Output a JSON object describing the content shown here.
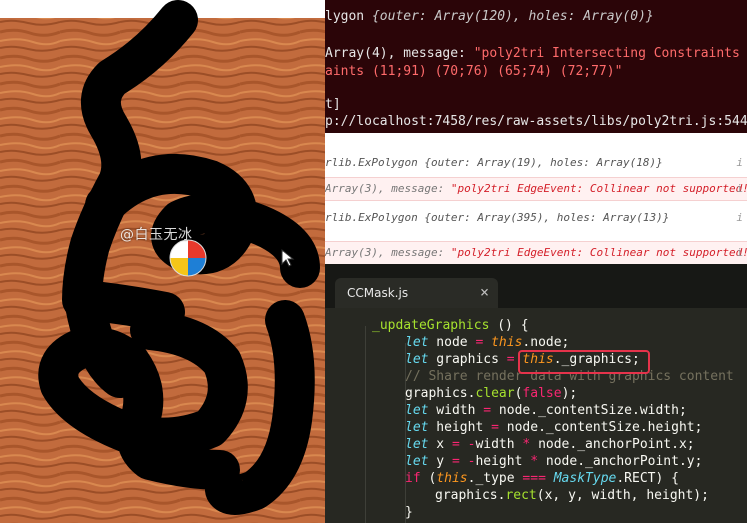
{
  "console": {
    "top": {
      "line1_label": "lygon ",
      "line1_detail": "{outer: Array(120), holes: Array(0)}",
      "line2_key": "Array(4), message: ",
      "line2_msg": "\"poly2tri Intersecting Constraints (",
      "line3": "aints (11;91) (70;76) (65;74) (72;77)\"",
      "line4": "t]",
      "line5": "p://localhost:7458/res/raw-assets/libs/poly2tri.js:544:2"
    },
    "rows": [
      {
        "kind": "log",
        "text": "rlib.ExPolygon {outer: Array(19), holes: Array(18)}",
        "right": "i"
      },
      {
        "kind": "err",
        "key": "Array(3), message: ",
        "msg": "\"poly2tri EdgeEvent: Collinear not supported!",
        "right": "i"
      },
      {
        "kind": "log",
        "text": "rlib.ExPolygon {outer: Array(395), holes: Array(13)}",
        "right": "i"
      },
      {
        "kind": "err",
        "key": "Array(3), message: ",
        "msg": "\"poly2tri EdgeEvent: Collinear not supported!",
        "right": "i"
      }
    ]
  },
  "editor": {
    "tab_label": "CCMask.js",
    "tab_close": "×",
    "lines": {
      "l1_fn": "_updateGraphics",
      "l1_rest": " () {",
      "l2_kw": "let",
      "l2_a": " node ",
      "l2_op": "=",
      "l2_this": " this",
      "l2_b": ".node;",
      "l3_kw": "let",
      "l3_a": " graphics ",
      "l3_op": "=",
      "l3_this": " this",
      "l3_b": "._graphics;",
      "l4": "// Share render data with graphics content",
      "l5_a": "graphics.",
      "l5_fn": "clear",
      "l5_b": "(",
      "l5_c": "false",
      "l5_d": ");",
      "l6_kw": "let",
      "l6_a": " width ",
      "l6_op": "=",
      "l6_b": " node._contentSize.width;",
      "l7_kw": "let",
      "l7_a": " height ",
      "l7_op": "=",
      "l7_b": " node._contentSize.height;",
      "l8_kw": "let",
      "l8_a": " x ",
      "l8_op": "= -",
      "l8_b": "width ",
      "l8_op2": "*",
      "l8_c": " node._anchorPoint.x;",
      "l9_kw": "let",
      "l9_a": " y ",
      "l9_op": "= -",
      "l9_b": "height ",
      "l9_op2": "*",
      "l9_c": " node._anchorPoint.y;",
      "l10_kw": "if",
      "l10_a": " (",
      "l10_this": "this",
      "l10_b": "._type ",
      "l10_op": "===",
      "l10_ty": " MaskType",
      "l10_c": ".RECT) {",
      "l11_a": "graphics.",
      "l11_fn": "rect",
      "l11_b": "(x, y, width, height);",
      "l12": "}"
    }
  },
  "game": {
    "watermark": "@白玉无冰",
    "colors": {
      "sand": "#c06a3c",
      "path": "#000000"
    }
  }
}
